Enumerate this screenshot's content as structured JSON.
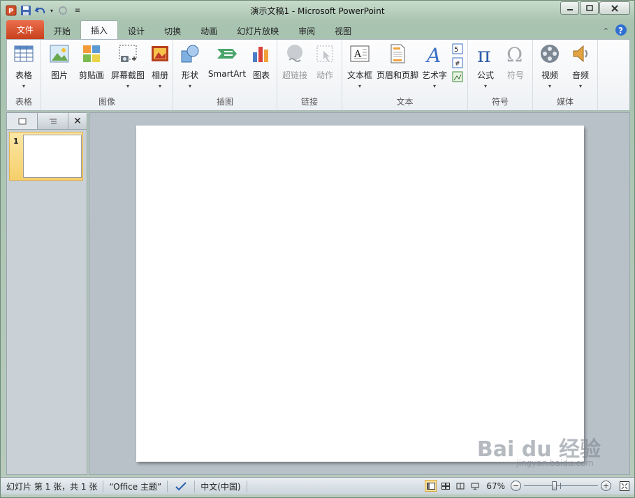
{
  "window": {
    "title": "演示文稿1 - Microsoft PowerPoint"
  },
  "tabs": [
    {
      "label": "文件"
    },
    {
      "label": "开始"
    },
    {
      "label": "插入"
    },
    {
      "label": "设计"
    },
    {
      "label": "切换"
    },
    {
      "label": "动画"
    },
    {
      "label": "幻灯片放映"
    },
    {
      "label": "审阅"
    },
    {
      "label": "视图"
    }
  ],
  "ribbon": {
    "groups": {
      "table": "表格",
      "images": "图像",
      "illustrations": "插图",
      "links": "链接",
      "text": "文本",
      "symbols": "符号",
      "media": "媒体"
    },
    "buttons": {
      "table": "表格",
      "picture": "图片",
      "clipart": "剪贴画",
      "screenshot": "屏幕截图",
      "album": "相册",
      "shapes": "形状",
      "smartart": "SmartArt",
      "chart": "图表",
      "hyperlink": "超链接",
      "action": "动作",
      "textbox": "文本框",
      "header_footer": "页眉和页脚",
      "wordart": "艺术字",
      "equation": "公式",
      "symbol": "符号",
      "video": "视频",
      "audio": "音频"
    }
  },
  "slides_panel": {
    "thumb_number": "1"
  },
  "status": {
    "slide_info": "幻灯片 第 1 张，共 1 张",
    "theme": "“Office 主题”",
    "language": "中文(中国)",
    "zoom": "67%"
  },
  "watermark": {
    "main": "Bai du 经验",
    "sub": "jingyan.baidu.com"
  },
  "colors": {
    "file_tab": "#d0502c",
    "thumb_selected": "#f6cf6a"
  }
}
